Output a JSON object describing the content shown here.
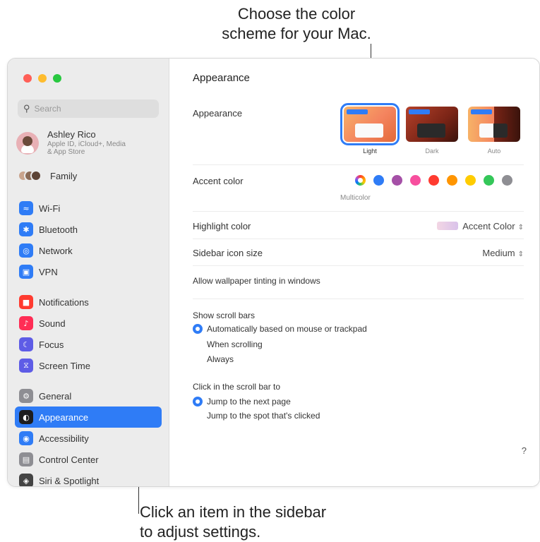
{
  "callouts": {
    "top_line1": "Choose the color",
    "top_line2": "scheme for your Mac.",
    "bottom_line1": "Click an item in the sidebar",
    "bottom_line2": "to adjust settings."
  },
  "colors": {
    "accent": "#2f7cf6",
    "red": "#ff5f57",
    "yellow": "#febc2e",
    "green": "#28c840"
  },
  "sidebar": {
    "search_placeholder": "Search",
    "profile": {
      "name": "Ashley Rico",
      "subtitle_line1": "Apple ID, iCloud+, Media",
      "subtitle_line2": "& App Store"
    },
    "family_label": "Family",
    "groups": [
      [
        {
          "label": "Wi-Fi",
          "icon": "wifi-icon",
          "color": "#2f7cf6"
        },
        {
          "label": "Bluetooth",
          "icon": "bluetooth-icon",
          "color": "#2f7cf6"
        },
        {
          "label": "Network",
          "icon": "globe-icon",
          "color": "#2f7cf6"
        },
        {
          "label": "VPN",
          "icon": "vpn-icon",
          "color": "#2f7cf6"
        }
      ],
      [
        {
          "label": "Notifications",
          "icon": "notifications-icon",
          "color": "#ff3b30"
        },
        {
          "label": "Sound",
          "icon": "sound-icon",
          "color": "#ff2d55"
        },
        {
          "label": "Focus",
          "icon": "moon-icon",
          "color": "#5e5ce6"
        },
        {
          "label": "Screen Time",
          "icon": "hourglass-icon",
          "color": "#5e5ce6"
        }
      ],
      [
        {
          "label": "General",
          "icon": "gear-icon",
          "color": "#8e8e93"
        },
        {
          "label": "Appearance",
          "icon": "appearance-icon",
          "color": "#1d1d1f",
          "selected": true
        },
        {
          "label": "Accessibility",
          "icon": "accessibility-icon",
          "color": "#2f7cf6"
        },
        {
          "label": "Control Center",
          "icon": "control-center-icon",
          "color": "#8e8e93"
        },
        {
          "label": "Siri & Spotlight",
          "icon": "siri-icon",
          "color": "#444444"
        }
      ]
    ]
  },
  "main": {
    "title": "Appearance",
    "appearance_label": "Appearance",
    "appearance_options": [
      {
        "label": "Light",
        "selected": true
      },
      {
        "label": "Dark",
        "selected": false
      },
      {
        "label": "Auto",
        "selected": false
      }
    ],
    "accent_label": "Accent color",
    "accent_selected": "Multicolor",
    "accent_colors": [
      "multicolor",
      "#2f7cf6",
      "#a550a7",
      "#f74f9e",
      "#ff3b30",
      "#ff9500",
      "#ffcc00",
      "#34c759",
      "#8e8e93"
    ],
    "highlight_label": "Highlight color",
    "highlight_value": "Accent Color",
    "icon_size_label": "Sidebar icon size",
    "icon_size_value": "Medium",
    "tinting_label": "Allow wallpaper tinting in windows",
    "scroll_bars_label": "Show scroll bars",
    "scroll_bars_options": [
      {
        "label": "Automatically based on mouse or trackpad",
        "selected": true
      },
      {
        "label": "When scrolling",
        "selected": false
      },
      {
        "label": "Always",
        "selected": false
      }
    ],
    "click_label": "Click in the scroll bar to",
    "click_options": [
      {
        "label": "Jump to the next page",
        "selected": true
      },
      {
        "label": "Jump to the spot that's clicked",
        "selected": false
      }
    ],
    "help_label": "?"
  }
}
